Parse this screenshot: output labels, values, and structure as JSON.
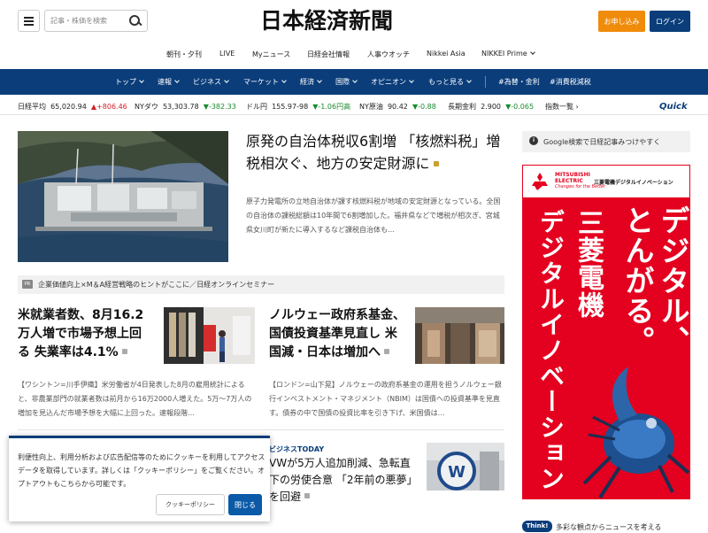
{
  "header": {
    "logo": "日本経済新聞",
    "search_placeholder": "記事・株価を検索",
    "apply_label": "お申し込み",
    "login_label": "ログイン"
  },
  "subnav": [
    "朝刊・夕刊",
    "LIVE",
    "Myニュース",
    "日経会社情報",
    "人事ウオッチ",
    "Nikkei Asia",
    "NIKKEI Prime"
  ],
  "mainnav": [
    "トップ",
    "速報",
    "ビジネス",
    "マーケット",
    "経済",
    "国際",
    "オピニオン",
    "もっと見る",
    "#為替・金利",
    "#消費税減税"
  ],
  "ticker": {
    "items": [
      {
        "label": "日経平均",
        "value": "65,020.94",
        "change": "+806.46",
        "dir": "up"
      },
      {
        "label": "NYダウ",
        "value": "53,303.78",
        "change": "-382.33",
        "dir": "down"
      },
      {
        "label": "ドル円",
        "value": "155.97-98",
        "change": "-1.06円高",
        "dir": "down"
      },
      {
        "label": "NY原油",
        "value": "90.42",
        "change": "-0.88",
        "dir": "down"
      },
      {
        "label": "長期金利",
        "value": "2.900",
        "change": "-0.065",
        "dir": "down"
      }
    ],
    "index_list": "指数一覧",
    "quick": "Quick"
  },
  "top_story": {
    "headline": "原発の自治体税収6割増 「核燃料税」増税相次ぐ、地方の安定財源に",
    "lead": "原子力発電所の立地自治体が課す核燃料税が地域の安定財源となっている。全国の自治体の課税総額は10年間で6割増加した。福井県などで増税が相次ぎ、宮城県女川町が新たに導入するなど課税自治体も…"
  },
  "seminar": {
    "tag": "PR",
    "text": "企業価値向上×M＆A経営戦略のヒントがここに／日経オンラインセミナー"
  },
  "story2": {
    "headline": "米就業者数、8月16.2万人増で市場予想上回る 失業率は4.1%",
    "lead": "【ワシントン=川手伊織】米労働省が4日発表した8月の雇用統計によると、非農業部門の就業者数は前月から16万2000人増えた。5万〜7万人の増加を見込んだ市場予想を大幅に上回った。速報段階…"
  },
  "story3": {
    "headline": "ノルウェー政府系基金、国債投資基準見直し 米国減・日本は増加へ",
    "lead": "【ロンドン=山下晃】ノルウェーの政府系基金の運用を担うノルウェー銀行インベストメント・マネジメント（NBIM）は国債への投資基準を見直す。債券の中で国債の投資比率を引き下げ、米国債は…"
  },
  "story4": {
    "label": "ビジネスTODAY",
    "headline": "VWが5万人追加削減、急転直下の労使合意 「2年前の悪夢」を回避"
  },
  "sidebar": {
    "google_text": "Google検索で日経記事みつけやすく",
    "bottom_badge": "Think!",
    "bottom_text": "多彩な観点からニュースを考える"
  },
  "ad": {
    "brand_line1": "MITSUBISHI",
    "brand_line2": "ELECTRIC",
    "tagline": "Changes for the Better",
    "sub": "三菱電機デジタルイノベーション",
    "col1": "デジタル、",
    "col2": "とんがる。",
    "col3": "三菱電機",
    "col4": "デジタルイノベーション",
    "red": "#e4001f"
  },
  "cookie": {
    "text": "利便性向上、利用分析および広告配信等のためにクッキーを利用してアクセスデータを取得しています。詳しくは「クッキーポリシー」をご覧ください。オプトアウトもこちらから可能です。",
    "policy_label": "クッキーポリシー",
    "close_label": "閉じる"
  },
  "colors": {
    "navy": "#0a3d7a",
    "orange": "#f08c0a",
    "up": "#d31f27",
    "down": "#1a8c2e"
  }
}
